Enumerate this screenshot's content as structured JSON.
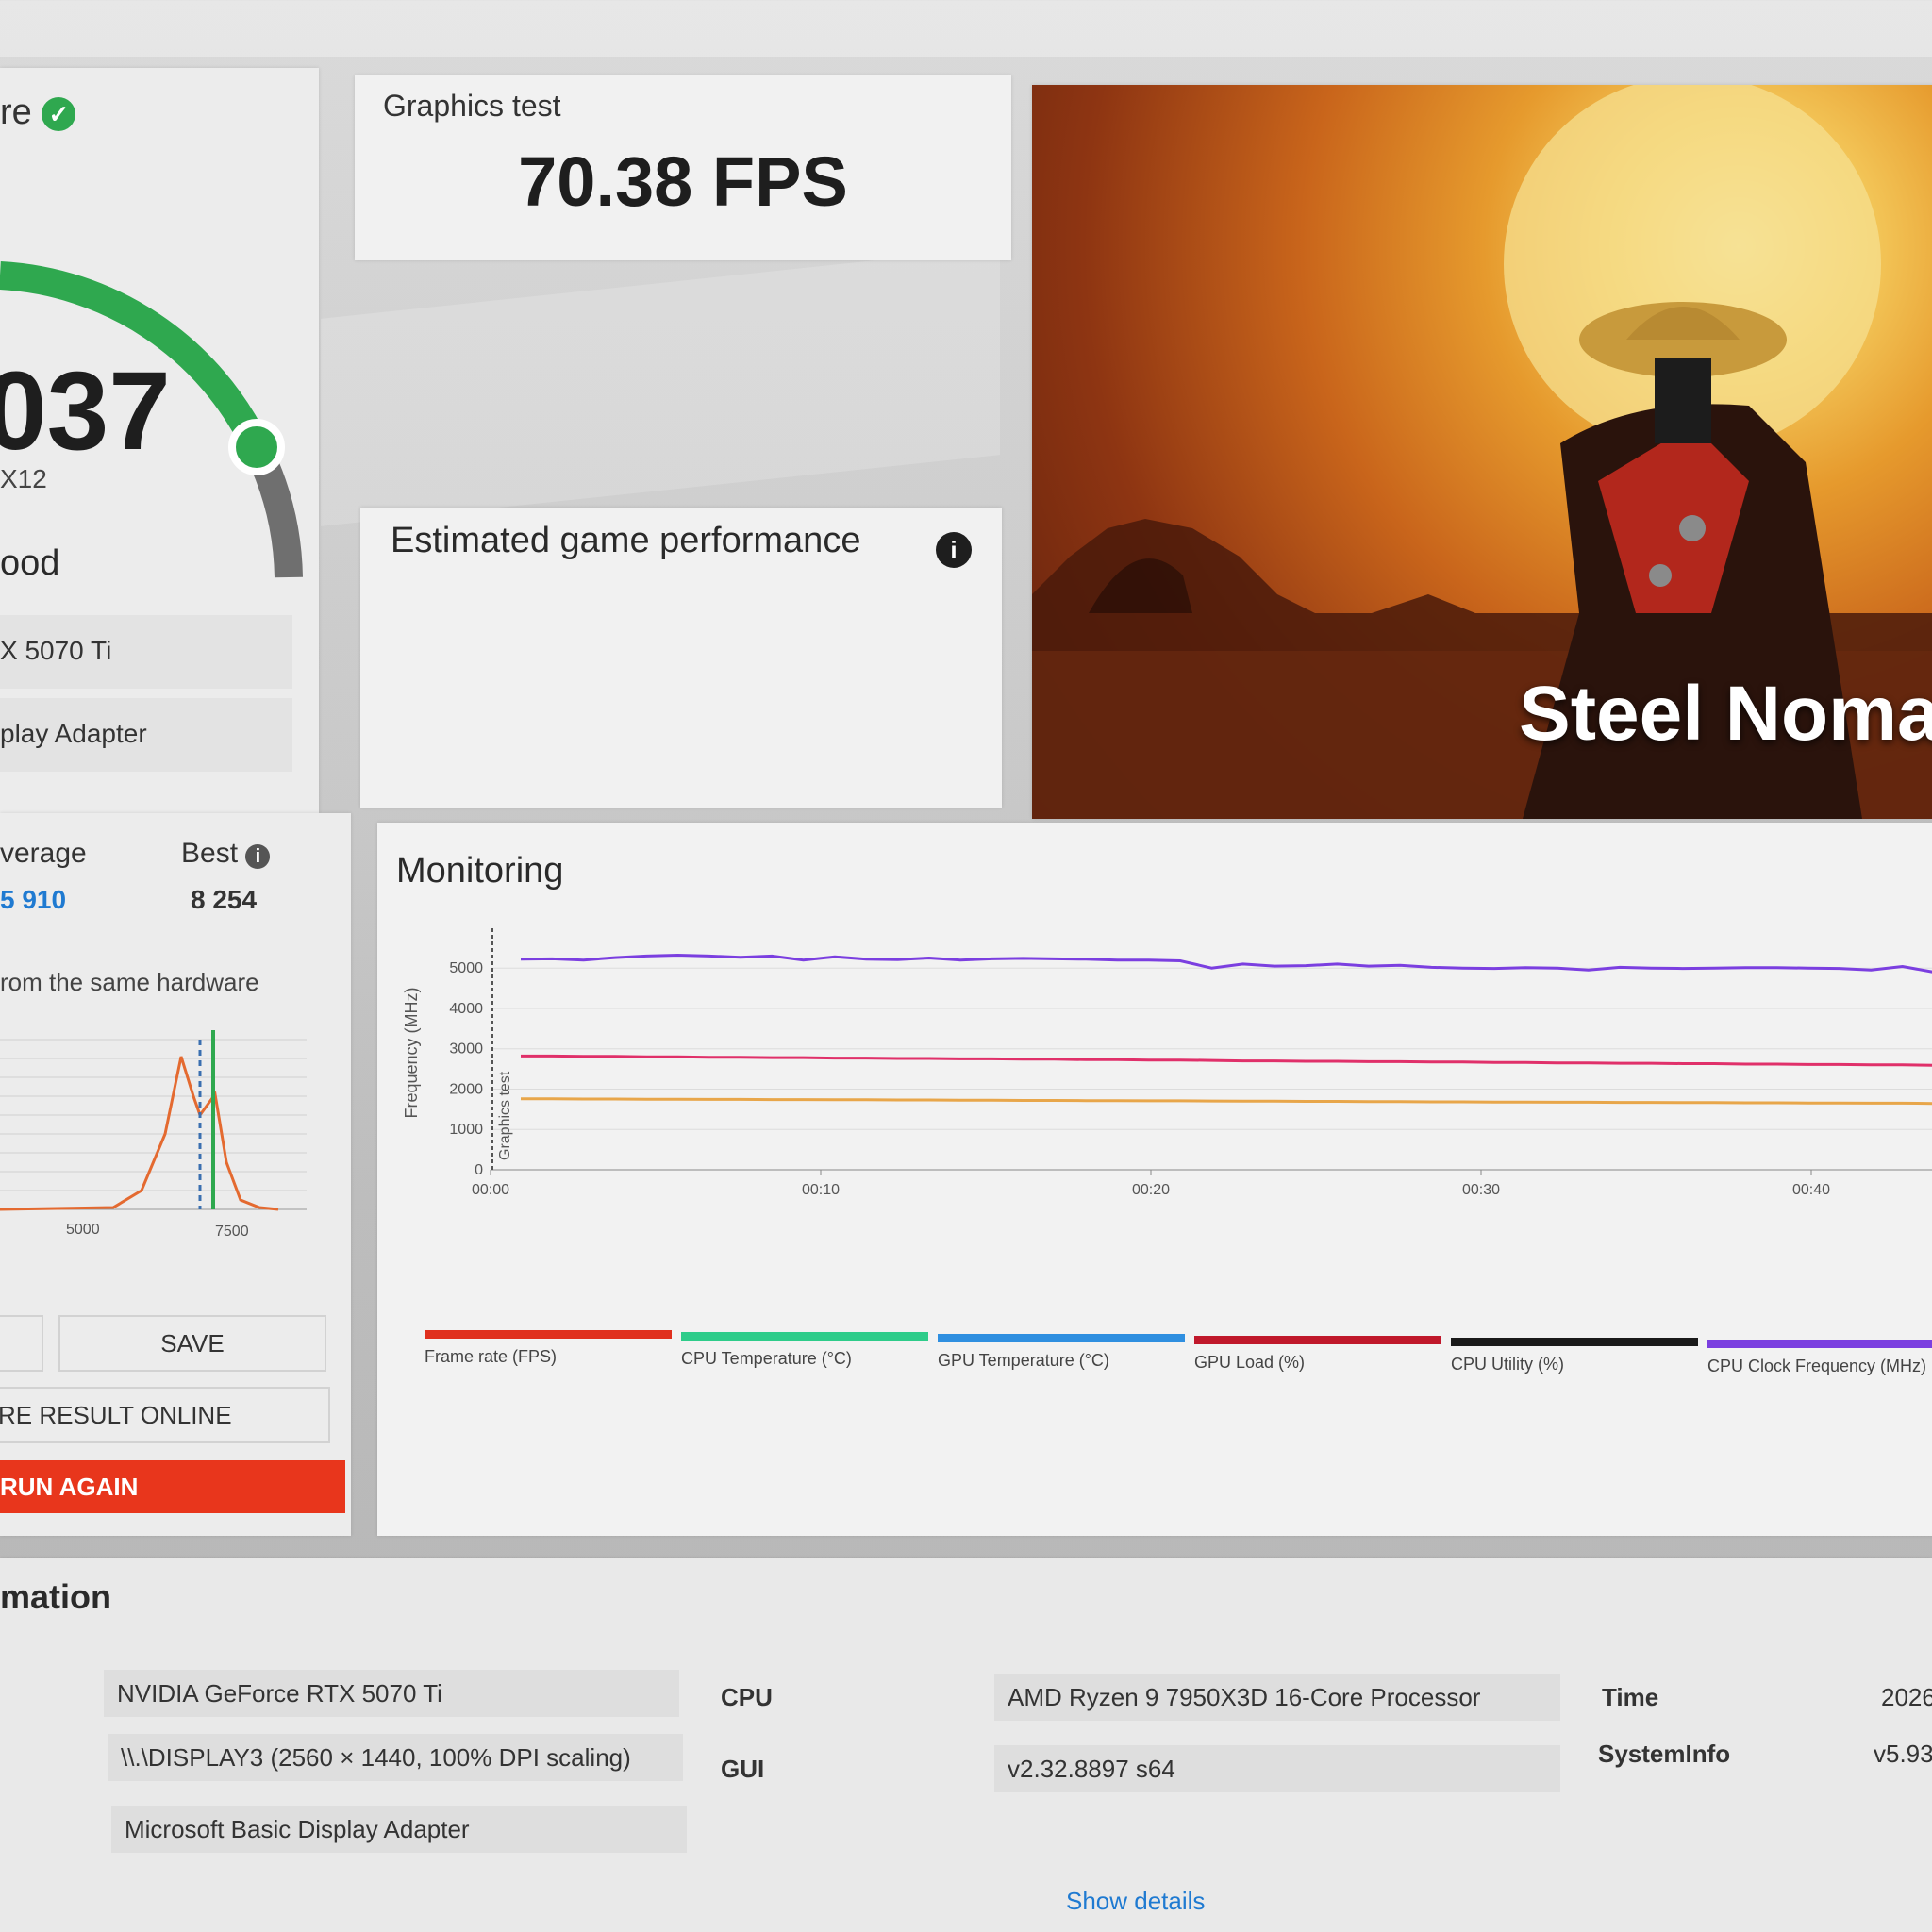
{
  "score_panel": {
    "title_fragment": "re",
    "score": "037",
    "api": "X12",
    "rating": "ood",
    "gpu_row": "X 5070 Ti",
    "adapter_row": "play Adapter",
    "average_label": "verage",
    "average_value": "5 910",
    "best_label": "Best",
    "best_value": "8 254",
    "same_hardware_text": "rom the same hardware",
    "dist_ticks": [
      "5000",
      "7500"
    ],
    "save_label": "SAVE",
    "share_label": "RE RESULT ONLINE",
    "run_again_label": "RUN AGAIN",
    "gauge_color": "#2fa84f"
  },
  "graphics_test": {
    "label": "Graphics test",
    "value": "70.38 FPS"
  },
  "estimated": {
    "title": "Estimated game performance",
    "info_icon": "info-icon"
  },
  "hero": {
    "title": "Steel Nomad"
  },
  "monitoring": {
    "title": "Monitoring",
    "y_label": "Frequency (MHz)",
    "marker_label": "Graphics test",
    "legend": [
      {
        "label": "Frame rate (FPS)",
        "color": "#e0301e"
      },
      {
        "label": "CPU Temperature (°C)",
        "color": "#2ecc8a"
      },
      {
        "label": "GPU Temperature (°C)",
        "color": "#2f8fe0"
      },
      {
        "label": "GPU Load (%)",
        "color": "#c0182b"
      },
      {
        "label": "CPU Utility (%)",
        "color": "#1a1a1a"
      },
      {
        "label": "CPU Clock Frequency (MHz)",
        "color": "#7b3fe0"
      }
    ]
  },
  "chart_data": {
    "type": "line",
    "ylabel": "Frequency (MHz)",
    "ylim": [
      0,
      5800
    ],
    "y_ticks": [
      "0",
      "1000",
      "2000",
      "3000",
      "4000",
      "5000"
    ],
    "x_ticks": [
      "00:00",
      "00:10",
      "00:20",
      "00:30",
      "00:40"
    ],
    "x": [
      1,
      2,
      3,
      4,
      5,
      6,
      7,
      8,
      9,
      10,
      11,
      12,
      13,
      14,
      15,
      16,
      17,
      18,
      19,
      20,
      21,
      22,
      23,
      24,
      25,
      26,
      27,
      28,
      29,
      30,
      31,
      32,
      33,
      34,
      35,
      36,
      37,
      38,
      39,
      40,
      41,
      42,
      43,
      44,
      45,
      46
    ],
    "series": [
      {
        "name": "CPU Clock Frequency (MHz)",
        "color": "#7b3fe0",
        "values": [
          5220,
          5230,
          5200,
          5260,
          5300,
          5320,
          5300,
          5270,
          5300,
          5200,
          5280,
          5220,
          5210,
          5250,
          5200,
          5230,
          5240,
          5230,
          5220,
          5200,
          5200,
          5180,
          5000,
          5100,
          5050,
          5060,
          5100,
          5050,
          5070,
          5020,
          5000,
          4990,
          5010,
          5000,
          4950,
          5020,
          5000,
          4990,
          5000,
          5010,
          5010,
          5000,
          4990,
          4950,
          5040,
          4900
        ]
      },
      {
        "name": "",
        "color": "#e0306a",
        "values": [
          2820,
          2820,
          2810,
          2810,
          2800,
          2800,
          2790,
          2790,
          2780,
          2780,
          2770,
          2770,
          2760,
          2760,
          2750,
          2750,
          2740,
          2740,
          2730,
          2730,
          2720,
          2720,
          2710,
          2700,
          2700,
          2690,
          2690,
          2680,
          2680,
          2670,
          2670,
          2660,
          2660,
          2650,
          2650,
          2640,
          2640,
          2630,
          2630,
          2620,
          2620,
          2610,
          2610,
          2600,
          2600,
          2590
        ]
      },
      {
        "name": "",
        "color": "#e8a64a",
        "values": [
          1760,
          1760,
          1755,
          1755,
          1750,
          1750,
          1745,
          1745,
          1740,
          1740,
          1735,
          1735,
          1730,
          1730,
          1725,
          1725,
          1720,
          1720,
          1715,
          1715,
          1710,
          1710,
          1705,
          1700,
          1700,
          1695,
          1695,
          1690,
          1690,
          1685,
          1685,
          1680,
          1680,
          1675,
          1675,
          1670,
          1670,
          1665,
          1665,
          1660,
          1660,
          1655,
          1655,
          1650,
          1650,
          1645
        ]
      }
    ]
  },
  "system_info": {
    "title_fragment": "mation",
    "gpu": "NVIDIA GeForce RTX 5070 Ti",
    "display": "\\\\.\\DISPLAY3 (2560 × 1440, 100% DPI scaling)",
    "adapter": "Microsoft Basic Display Adapter",
    "cpu_label": "CPU",
    "cpu_value": "AMD Ryzen 9 7950X3D 16-Core Processor",
    "gui_label": "GUI",
    "gui_value": "v2.32.8897 s64",
    "time_label": "Time",
    "time_value": "2026",
    "sysinfo_label": "SystemInfo",
    "sysinfo_value": "v5.93",
    "show_details": "Show details"
  }
}
